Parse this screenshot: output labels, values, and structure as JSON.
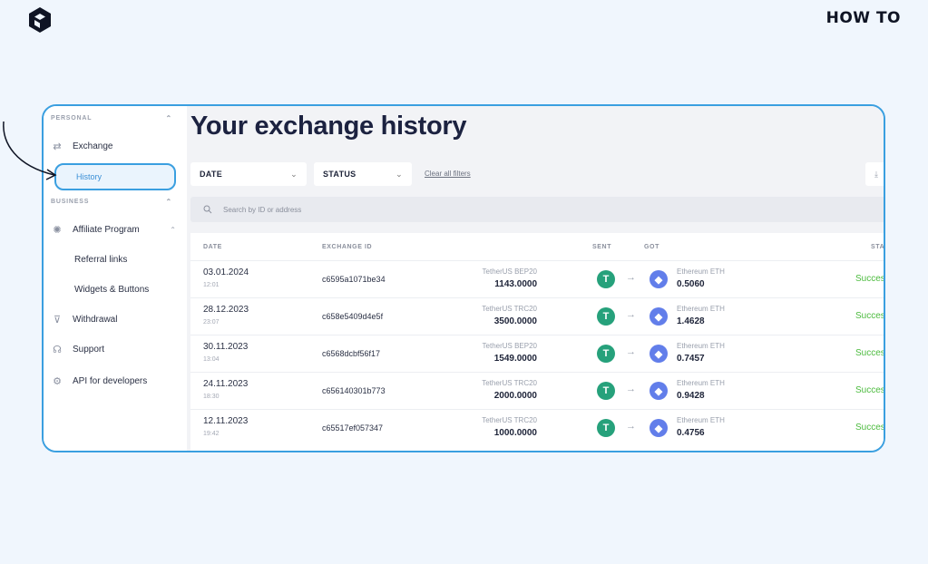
{
  "brand": {
    "howto": "HOW TO"
  },
  "sidebar": {
    "personal_heading": "PERSONAL",
    "business_heading": "BUSINESS",
    "items": {
      "exchange": "Exchange",
      "history": "History",
      "affiliate": "Affiliate Program",
      "referral": "Referral links",
      "widgets": "Widgets & Buttons",
      "withdrawal": "Withdrawal",
      "support": "Support",
      "api": "API for developers"
    }
  },
  "main": {
    "title": "Your exchange history",
    "filters": {
      "date": "DATE",
      "status": "STATUS",
      "clear": "Clear all filters"
    },
    "search_placeholder": "Search by ID or address",
    "table": {
      "headers": {
        "date": "DATE",
        "id": "EXCHANGE ID",
        "sent": "SENT",
        "got": "GOT",
        "status": "STA"
      },
      "rows": [
        {
          "date": "03.01.2024",
          "time": "12:01",
          "id": "c6595a1071be34",
          "sent_name": "TetherUS BEP20",
          "sent_amt": "1143.0000",
          "got_name": "Ethereum ETH",
          "got_amt": "0.5060",
          "status": "Success"
        },
        {
          "date": "28.12.2023",
          "time": "23:07",
          "id": "c658e5409d4e5f",
          "sent_name": "TetherUS TRC20",
          "sent_amt": "3500.0000",
          "got_name": "Ethereum ETH",
          "got_amt": "1.4628",
          "status": "Success"
        },
        {
          "date": "30.11.2023",
          "time": "13:04",
          "id": "c6568dcbf56f17",
          "sent_name": "TetherUS BEP20",
          "sent_amt": "1549.0000",
          "got_name": "Ethereum ETH",
          "got_amt": "0.7457",
          "status": "Success"
        },
        {
          "date": "24.11.2023",
          "time": "18:30",
          "id": "c656140301b773",
          "sent_name": "TetherUS TRC20",
          "sent_amt": "2000.0000",
          "got_name": "Ethereum ETH",
          "got_amt": "0.9428",
          "status": "Success"
        },
        {
          "date": "12.11.2023",
          "time": "19:42",
          "id": "c65517ef057347",
          "sent_name": "TetherUS TRC20",
          "sent_amt": "1000.0000",
          "got_name": "Ethereum ETH",
          "got_amt": "0.4756",
          "status": "Success"
        }
      ]
    }
  },
  "colors": {
    "accent": "#3a9fe0",
    "usdt": "#26a17b",
    "eth": "#627eea",
    "success": "#4cbb3e"
  }
}
